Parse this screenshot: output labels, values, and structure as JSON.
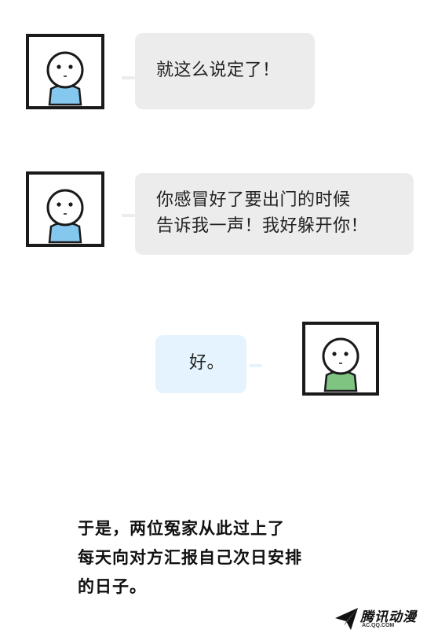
{
  "dialogue": [
    {
      "speaker": "blue",
      "lines": [
        "就这么说定了！"
      ]
    },
    {
      "speaker": "blue",
      "lines": [
        "你感冒好了要出门的时候",
        "告诉我一声！我好躲开你！"
      ]
    },
    {
      "speaker": "green",
      "lines": [
        "好。"
      ]
    }
  ],
  "narration": {
    "lines": [
      "于是，两位冤家从此过上了",
      "每天向对方汇报自己次日安排",
      "的日子。"
    ]
  },
  "watermark": {
    "name": "腾讯动漫",
    "url": "AC.QQ.COM"
  },
  "colors": {
    "blue_shirt": "#84c8ef",
    "green_shirt": "#7fc581",
    "bubble_gray": "#ececec",
    "bubble_blue": "#e4f3fd"
  }
}
